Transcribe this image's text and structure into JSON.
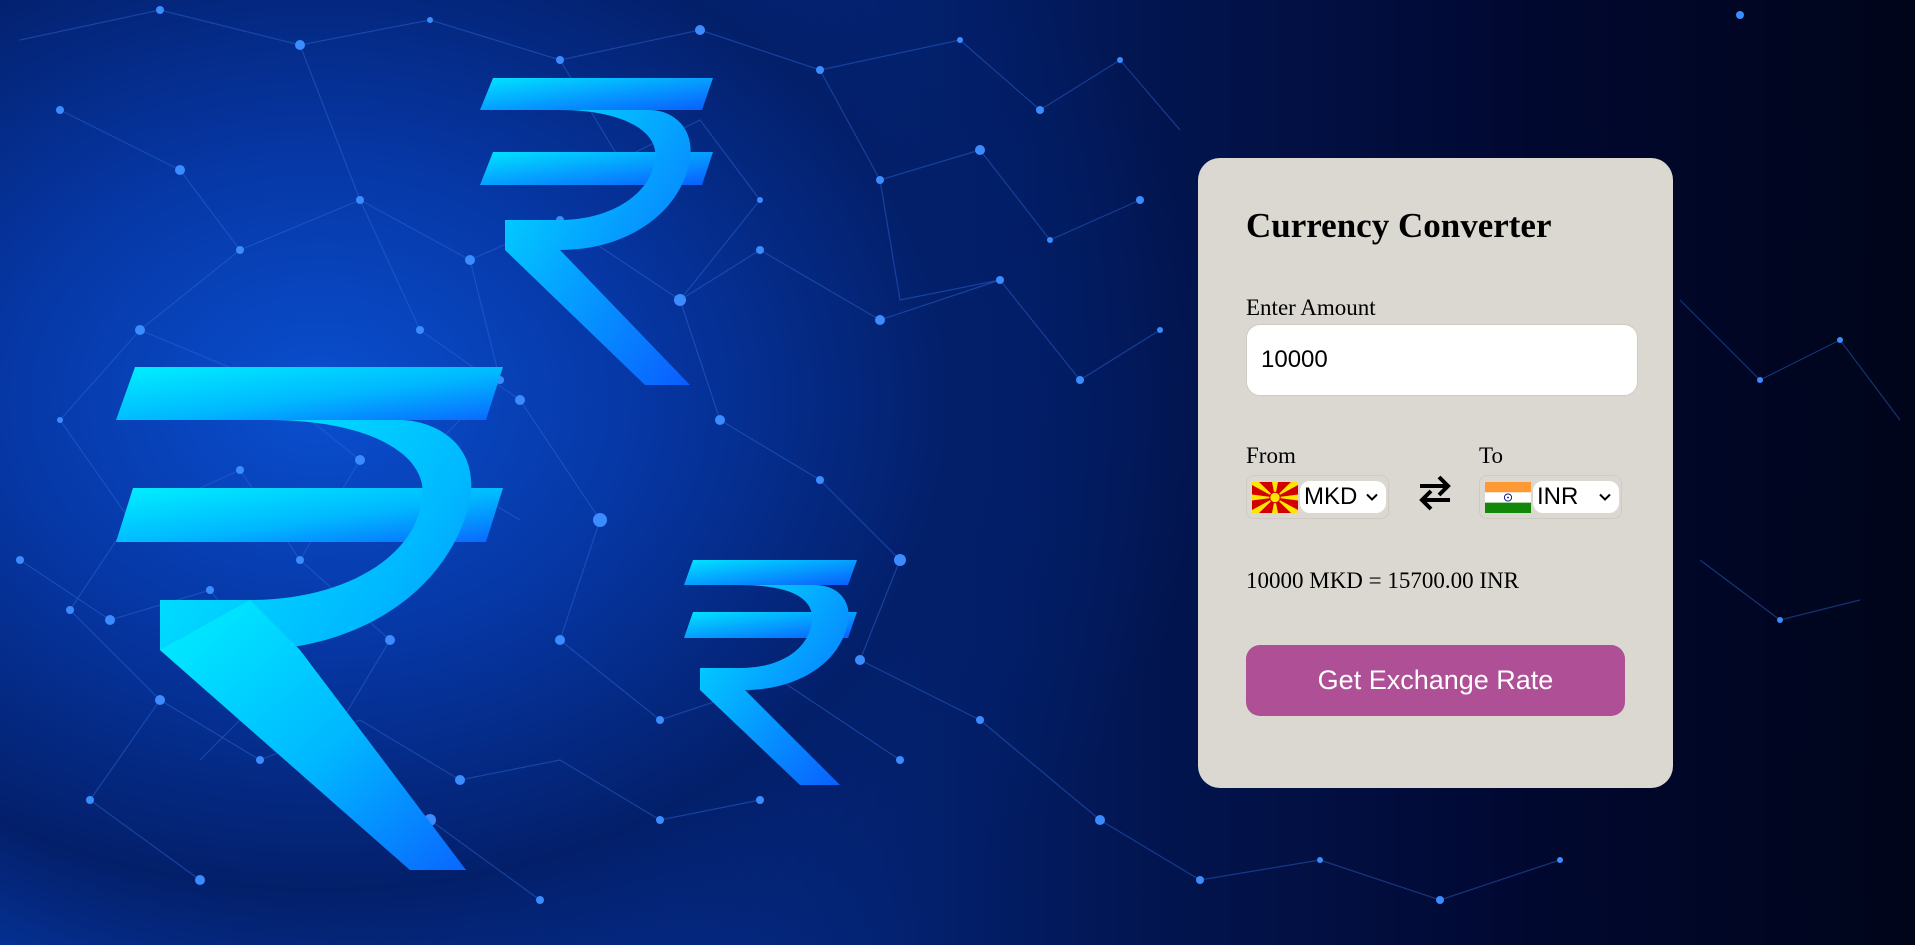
{
  "converter": {
    "title": "Currency Converter",
    "amount_label": "Enter Amount",
    "amount_value": "10000",
    "from_label": "From",
    "from_currency": "MKD",
    "from_flag": "macedonia-flag",
    "to_label": "To",
    "to_currency": "INR",
    "to_flag": "india-flag",
    "swap_icon": "swap-arrows-icon",
    "result_text": "10000 MKD = 15700.00 INR",
    "button_label": "Get Exchange Rate"
  },
  "colors": {
    "card_bg": "#dbd7d1",
    "button_bg": "#af4f95",
    "button_text": "#ffffff",
    "background_primary": "#0640b8",
    "background_dark": "#00051a",
    "rupee_glow": "#00e5ff"
  },
  "background": {
    "icon": "rupee-symbol",
    "symbol": "₹"
  }
}
